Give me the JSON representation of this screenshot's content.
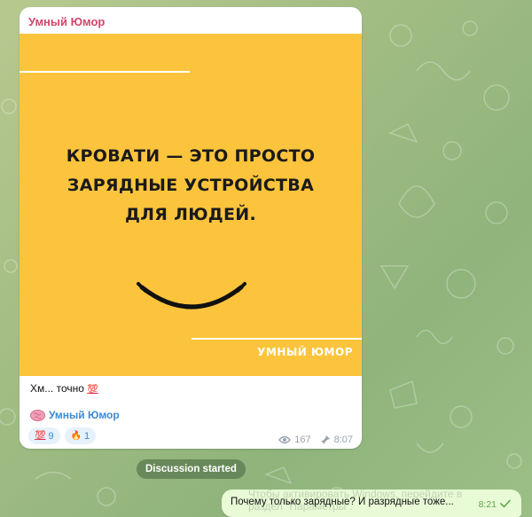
{
  "post": {
    "channel_name": "Умный Юмор",
    "image": {
      "headline_line1": "КРОВАТИ — ЭТО ПРОСТО",
      "headline_line2": "ЗАРЯДНЫЕ УСТРОЙСТВА",
      "headline_line3": "ДЛЯ ЛЮДЕЙ.",
      "brand": "УМНЫЙ ЮМОР",
      "background_color": "#fcc43c"
    },
    "caption_text": "Хм... точно",
    "caption_emoji": "💯",
    "signature": "Умный Юмор",
    "signature_icon": "brain-icon",
    "reactions": [
      {
        "icon": "💯",
        "icon_name": "hundred-points-icon",
        "count": "9"
      },
      {
        "icon": "🔥",
        "icon_name": "fire-icon",
        "count": "1"
      }
    ],
    "views": "167",
    "time": "8:07",
    "pinned_icon": "pin-icon"
  },
  "service_message": "Discussion started",
  "comment": {
    "text": "Почему только зарядные? И разрядные тоже...",
    "time": "8:21",
    "status_icon": "check-icon",
    "watermark_line1": "Чтобы активировать Windows, перейдите в",
    "watermark_line2": "раздел \"Параметры\"."
  }
}
